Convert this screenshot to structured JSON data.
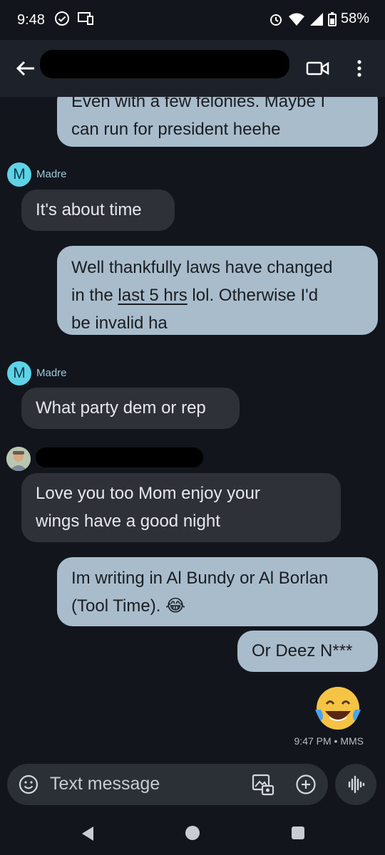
{
  "status_bar": {
    "time": "9:48",
    "battery": "58%"
  },
  "header": {
    "back": "back-arrow",
    "video": "video-call",
    "more": "more-options"
  },
  "messages": [
    {
      "kind": "out",
      "lines": [
        "Even with a few felonies.  Maybe I",
        "can run for president heehe"
      ]
    },
    {
      "kind": "sender",
      "initial": "M",
      "name": "Madre"
    },
    {
      "kind": "in",
      "text": "It's about time"
    },
    {
      "kind": "out",
      "line1": "Well thankfully laws have changed",
      "line2_pre": "in the ",
      "line2_link": "last 5 hrs",
      "line2_post": " lol. Otherwise I'd",
      "line3": "be invalid ha"
    },
    {
      "kind": "sender",
      "initial": "M",
      "name": "Madre"
    },
    {
      "kind": "in",
      "text": "What party dem or rep"
    },
    {
      "kind": "in",
      "lines": [
        "Love you too Mom enjoy your",
        "wings have a good night"
      ]
    },
    {
      "kind": "out",
      "lines": [
        "Im writing in Al Bundy or Al Borlan",
        "(Tool Time).  😂"
      ]
    },
    {
      "kind": "out",
      "text": "Or Deez N***"
    },
    {
      "kind": "emoji",
      "text": "😂"
    }
  ],
  "meta": {
    "timestamp": "9:47 PM • MMS"
  },
  "composer": {
    "placeholder": "Text message"
  },
  "colors": {
    "incoming": "#2e3238",
    "outgoing": "#a8bccb",
    "avatar": "#5ed2e6"
  }
}
